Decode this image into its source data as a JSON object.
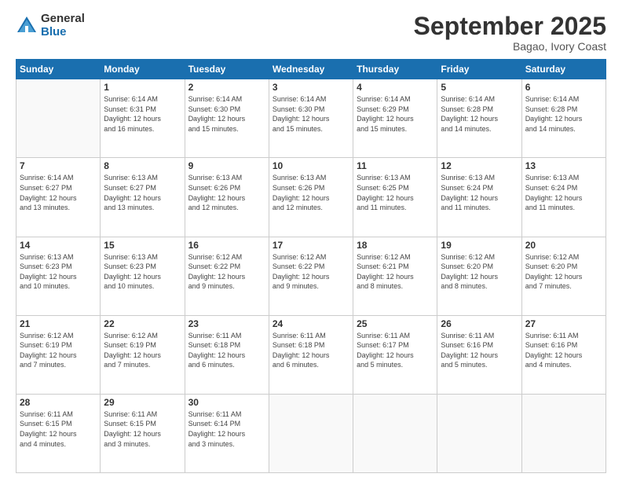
{
  "logo": {
    "general": "General",
    "blue": "Blue"
  },
  "header": {
    "month_year": "September 2025",
    "location": "Bagao, Ivory Coast"
  },
  "days_of_week": [
    "Sunday",
    "Monday",
    "Tuesday",
    "Wednesday",
    "Thursday",
    "Friday",
    "Saturday"
  ],
  "weeks": [
    [
      {
        "day": "",
        "info": ""
      },
      {
        "day": "1",
        "info": "Sunrise: 6:14 AM\nSunset: 6:31 PM\nDaylight: 12 hours\nand 16 minutes."
      },
      {
        "day": "2",
        "info": "Sunrise: 6:14 AM\nSunset: 6:30 PM\nDaylight: 12 hours\nand 15 minutes."
      },
      {
        "day": "3",
        "info": "Sunrise: 6:14 AM\nSunset: 6:30 PM\nDaylight: 12 hours\nand 15 minutes."
      },
      {
        "day": "4",
        "info": "Sunrise: 6:14 AM\nSunset: 6:29 PM\nDaylight: 12 hours\nand 15 minutes."
      },
      {
        "day": "5",
        "info": "Sunrise: 6:14 AM\nSunset: 6:28 PM\nDaylight: 12 hours\nand 14 minutes."
      },
      {
        "day": "6",
        "info": "Sunrise: 6:14 AM\nSunset: 6:28 PM\nDaylight: 12 hours\nand 14 minutes."
      }
    ],
    [
      {
        "day": "7",
        "info": "Sunrise: 6:14 AM\nSunset: 6:27 PM\nDaylight: 12 hours\nand 13 minutes."
      },
      {
        "day": "8",
        "info": "Sunrise: 6:13 AM\nSunset: 6:27 PM\nDaylight: 12 hours\nand 13 minutes."
      },
      {
        "day": "9",
        "info": "Sunrise: 6:13 AM\nSunset: 6:26 PM\nDaylight: 12 hours\nand 12 minutes."
      },
      {
        "day": "10",
        "info": "Sunrise: 6:13 AM\nSunset: 6:26 PM\nDaylight: 12 hours\nand 12 minutes."
      },
      {
        "day": "11",
        "info": "Sunrise: 6:13 AM\nSunset: 6:25 PM\nDaylight: 12 hours\nand 11 minutes."
      },
      {
        "day": "12",
        "info": "Sunrise: 6:13 AM\nSunset: 6:24 PM\nDaylight: 12 hours\nand 11 minutes."
      },
      {
        "day": "13",
        "info": "Sunrise: 6:13 AM\nSunset: 6:24 PM\nDaylight: 12 hours\nand 11 minutes."
      }
    ],
    [
      {
        "day": "14",
        "info": "Sunrise: 6:13 AM\nSunset: 6:23 PM\nDaylight: 12 hours\nand 10 minutes."
      },
      {
        "day": "15",
        "info": "Sunrise: 6:13 AM\nSunset: 6:23 PM\nDaylight: 12 hours\nand 10 minutes."
      },
      {
        "day": "16",
        "info": "Sunrise: 6:12 AM\nSunset: 6:22 PM\nDaylight: 12 hours\nand 9 minutes."
      },
      {
        "day": "17",
        "info": "Sunrise: 6:12 AM\nSunset: 6:22 PM\nDaylight: 12 hours\nand 9 minutes."
      },
      {
        "day": "18",
        "info": "Sunrise: 6:12 AM\nSunset: 6:21 PM\nDaylight: 12 hours\nand 8 minutes."
      },
      {
        "day": "19",
        "info": "Sunrise: 6:12 AM\nSunset: 6:20 PM\nDaylight: 12 hours\nand 8 minutes."
      },
      {
        "day": "20",
        "info": "Sunrise: 6:12 AM\nSunset: 6:20 PM\nDaylight: 12 hours\nand 7 minutes."
      }
    ],
    [
      {
        "day": "21",
        "info": "Sunrise: 6:12 AM\nSunset: 6:19 PM\nDaylight: 12 hours\nand 7 minutes."
      },
      {
        "day": "22",
        "info": "Sunrise: 6:12 AM\nSunset: 6:19 PM\nDaylight: 12 hours\nand 7 minutes."
      },
      {
        "day": "23",
        "info": "Sunrise: 6:11 AM\nSunset: 6:18 PM\nDaylight: 12 hours\nand 6 minutes."
      },
      {
        "day": "24",
        "info": "Sunrise: 6:11 AM\nSunset: 6:18 PM\nDaylight: 12 hours\nand 6 minutes."
      },
      {
        "day": "25",
        "info": "Sunrise: 6:11 AM\nSunset: 6:17 PM\nDaylight: 12 hours\nand 5 minutes."
      },
      {
        "day": "26",
        "info": "Sunrise: 6:11 AM\nSunset: 6:16 PM\nDaylight: 12 hours\nand 5 minutes."
      },
      {
        "day": "27",
        "info": "Sunrise: 6:11 AM\nSunset: 6:16 PM\nDaylight: 12 hours\nand 4 minutes."
      }
    ],
    [
      {
        "day": "28",
        "info": "Sunrise: 6:11 AM\nSunset: 6:15 PM\nDaylight: 12 hours\nand 4 minutes."
      },
      {
        "day": "29",
        "info": "Sunrise: 6:11 AM\nSunset: 6:15 PM\nDaylight: 12 hours\nand 3 minutes."
      },
      {
        "day": "30",
        "info": "Sunrise: 6:11 AM\nSunset: 6:14 PM\nDaylight: 12 hours\nand 3 minutes."
      },
      {
        "day": "",
        "info": ""
      },
      {
        "day": "",
        "info": ""
      },
      {
        "day": "",
        "info": ""
      },
      {
        "day": "",
        "info": ""
      }
    ]
  ]
}
